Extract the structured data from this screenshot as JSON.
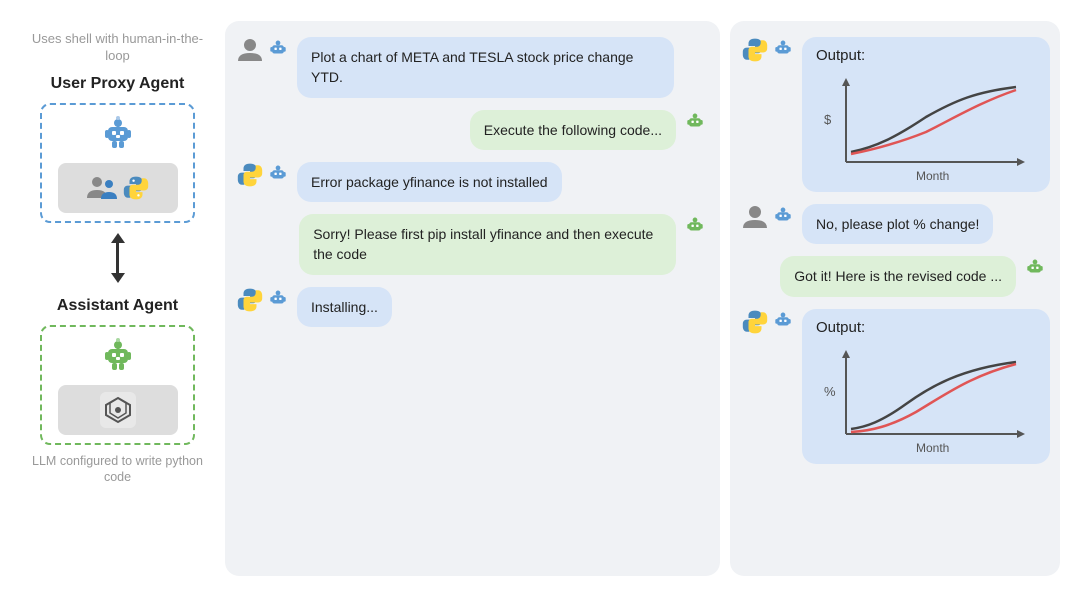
{
  "left": {
    "top_label": "Uses shell with human-in-the-loop",
    "user_proxy_label": "User Proxy Agent",
    "assistant_label": "Assistant Agent",
    "bottom_label": "LLM configured to write python code"
  },
  "chat": {
    "messages": [
      {
        "type": "user-left",
        "text": "Plot a chart of META and TESLA stock price change YTD."
      },
      {
        "type": "assistant-right",
        "text": "Execute the following code..."
      },
      {
        "type": "user-left",
        "text": "Error package yfinance is not installed"
      },
      {
        "type": "assistant-right",
        "text": "Sorry! Please first pip install yfinance and then execute the code"
      },
      {
        "type": "user-left",
        "text": "Installing..."
      }
    ]
  },
  "right": {
    "messages": [
      {
        "type": "output-chart",
        "title": "Output:",
        "y_label": "$",
        "x_label": "Month"
      },
      {
        "type": "user-left",
        "text": "No, please plot % change!"
      },
      {
        "type": "assistant-right",
        "text": "Got it! Here is the revised code ..."
      },
      {
        "type": "output-chart2",
        "title": "Output:",
        "y_label": "%",
        "x_label": "Month"
      }
    ]
  }
}
